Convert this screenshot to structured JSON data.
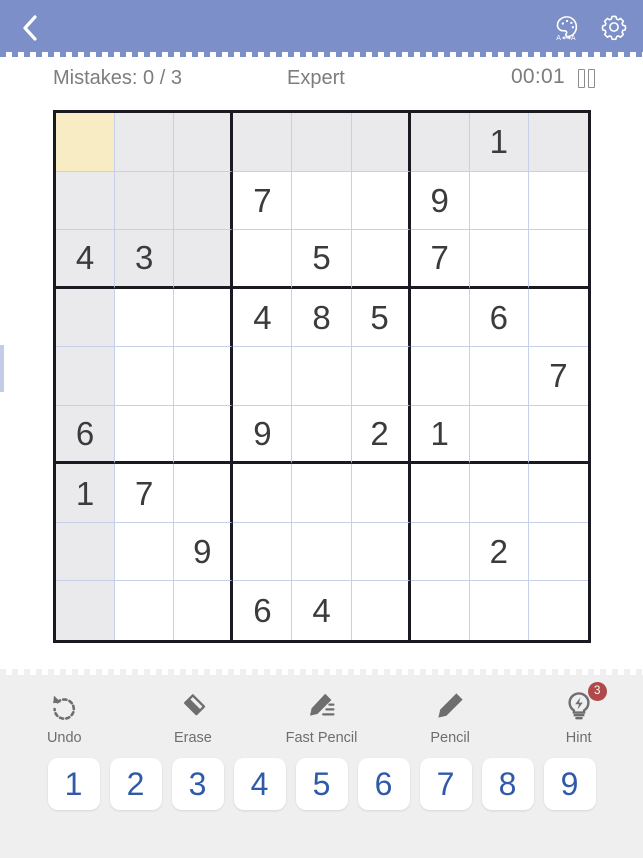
{
  "header": {
    "back_icon": "chevron-left-icon",
    "theme_icon": "palette-theme-icon",
    "settings_icon": "gear-icon"
  },
  "status": {
    "mistakes_label": "Mistakes: 0 / 3",
    "difficulty": "Expert",
    "timer": "00:01",
    "pause_icon": "pause-icon"
  },
  "board": {
    "selected": {
      "row": 0,
      "col": 0
    },
    "grid": [
      [
        "",
        "",
        "",
        "",
        "",
        "",
        "",
        "1",
        ""
      ],
      [
        "",
        "",
        "",
        "7",
        "",
        "",
        "9",
        "",
        ""
      ],
      [
        "4",
        "3",
        "",
        "",
        "5",
        "",
        "7",
        "",
        ""
      ],
      [
        "",
        "",
        "",
        "4",
        "8",
        "5",
        "",
        "6",
        ""
      ],
      [
        "",
        "",
        "",
        "",
        "",
        "",
        "",
        "",
        "7"
      ],
      [
        "6",
        "",
        "",
        "9",
        "",
        "2",
        "1",
        "",
        ""
      ],
      [
        "1",
        "7",
        "",
        "",
        "",
        "",
        "",
        "",
        ""
      ],
      [
        "",
        "",
        "9",
        "",
        "",
        "",
        "",
        "2",
        ""
      ],
      [
        "",
        "",
        "",
        "6",
        "4",
        "",
        "",
        "",
        ""
      ]
    ]
  },
  "tools": [
    {
      "label": "Undo",
      "icon": "undo-icon"
    },
    {
      "label": "Erase",
      "icon": "eraser-icon"
    },
    {
      "label": "Fast Pencil",
      "icon": "fast-pencil-icon"
    },
    {
      "label": "Pencil",
      "icon": "pencil-icon"
    },
    {
      "label": "Hint",
      "icon": "lightbulb-hint-icon",
      "badge": "3"
    }
  ],
  "numpad": [
    "1",
    "2",
    "3",
    "4",
    "5",
    "6",
    "7",
    "8",
    "9"
  ],
  "colors": {
    "header_bg": "#7d8fc9",
    "selected_cell": "#f7ecc3",
    "peer_cell": "#eaeaec",
    "number_key_text": "#2f5aa8",
    "badge": "#b04a4a",
    "grid_line": "#c7d0e8",
    "grid_border": "#1a1a22"
  }
}
